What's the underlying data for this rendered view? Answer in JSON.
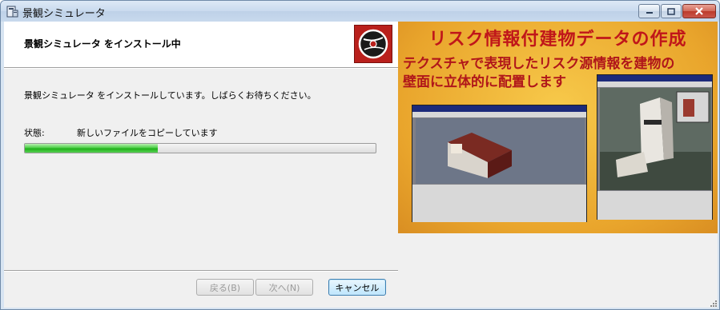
{
  "window": {
    "title": "景観シミュレータ",
    "icon": "installer-icon"
  },
  "header": {
    "title": "景観シミュレータ をインストール中",
    "logo_icon": "cd-install-icon"
  },
  "body": {
    "description": "景観シミュレータ をインストールしています。しばらくお待ちください。",
    "status_label": "状態:",
    "status_value": "新しいファイルをコピーしています",
    "progress_fraction": 0.38
  },
  "buttons": {
    "back": "戻る(B)",
    "next": "次へ(N)",
    "cancel": "キャンセル"
  },
  "banner": {
    "title": "リスク情報付建物データの作成",
    "line1": "テクスチャで表現したリスク源情報を建物の",
    "line2": "壁面に立体的に配置します"
  },
  "colors": {
    "accent_red": "#c0161a",
    "progress_green": "#1fb01a",
    "cancel_blue": "#3c7fb1"
  }
}
